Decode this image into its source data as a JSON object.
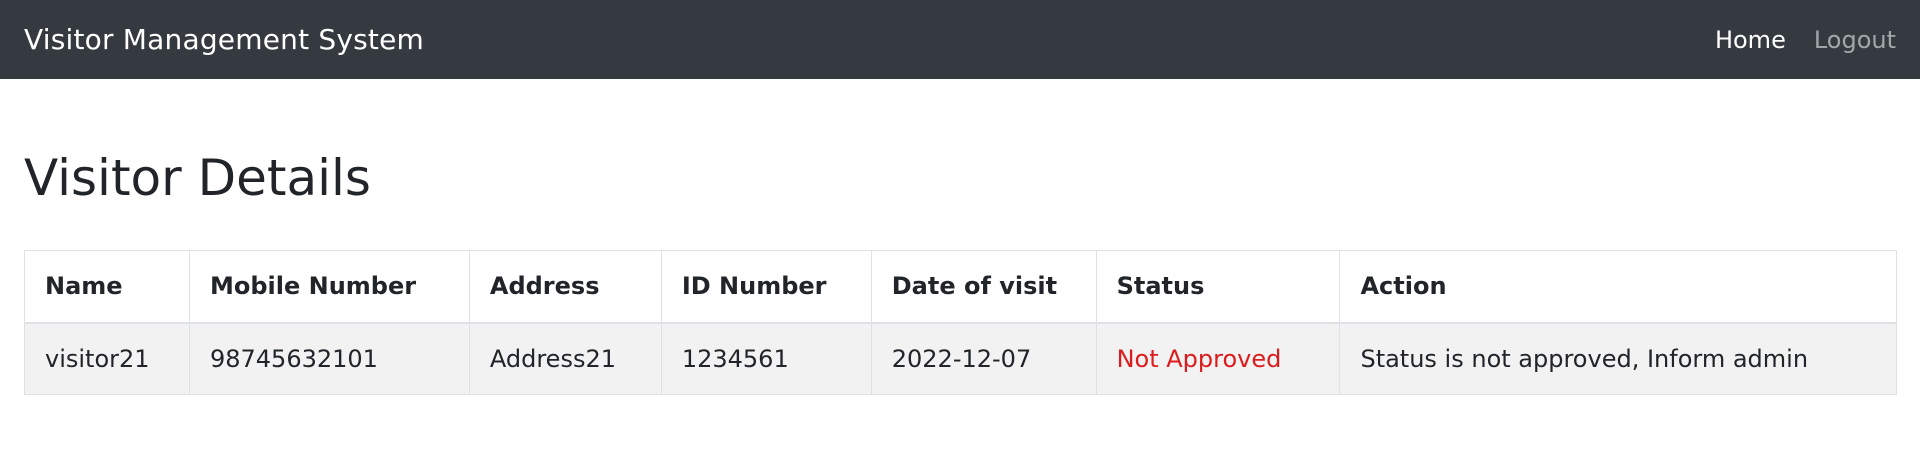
{
  "navbar": {
    "brand": "Visitor Management System",
    "links": [
      {
        "label": "Home",
        "active": true
      },
      {
        "label": "Logout",
        "active": false
      }
    ]
  },
  "page": {
    "title": "Visitor Details"
  },
  "table": {
    "headers": [
      "Name",
      "Mobile Number",
      "Address",
      "ID Number",
      "Date of visit",
      "Status",
      "Action"
    ],
    "rows": [
      {
        "name": "visitor21",
        "mobile": "98745632101",
        "address": "Address21",
        "id_number": "1234561",
        "date_of_visit": "2022-12-07",
        "status": "Not Approved",
        "action": "Status is not approved, Inform admin"
      }
    ]
  },
  "colors": {
    "navbar_bg": "#343a40",
    "status_not_approved": "#dc1c1c",
    "row_bg": "#f2f2f2"
  }
}
